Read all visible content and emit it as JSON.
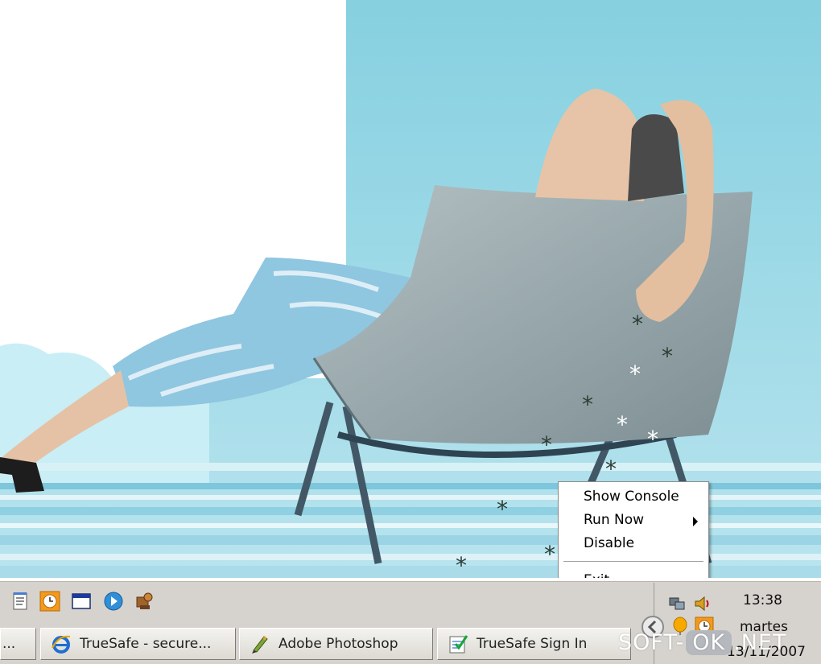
{
  "context_menu": {
    "items": [
      {
        "label": "Show Console",
        "has_submenu": false
      },
      {
        "label": "Run Now",
        "has_submenu": true
      },
      {
        "label": "Disable",
        "has_submenu": false
      },
      {
        "label": "Exit",
        "has_submenu": false
      }
    ]
  },
  "quick_launch": {
    "icons": [
      "notepad-icon",
      "clock-icon",
      "window-icon",
      "media-player-icon",
      "utility-icon"
    ]
  },
  "taskbar": {
    "buttons": [
      {
        "label": "...",
        "icon": "window-icon"
      },
      {
        "label": "TrueSafe - secure...",
        "icon": "internet-explorer-icon"
      },
      {
        "label": "Adobe Photoshop",
        "icon": "photoshop-icon"
      },
      {
        "label": "TrueSafe Sign In",
        "icon": "checklist-icon"
      }
    ]
  },
  "tray": {
    "time": "13:38",
    "day": "martes",
    "date": "13/11/2007",
    "icons": [
      "collapse-arrow-icon",
      "balloon-icon",
      "truesafe-clock-icon",
      "network-icon",
      "volume-icon"
    ]
  },
  "watermark": {
    "left": "SOFT-",
    "middle": "OK",
    "right": ".NET"
  },
  "colors": {
    "sky": "#9ed8e8",
    "wall": "#ffffff",
    "taskbar": "#d6d3ce",
    "chair": "#8f9fa4"
  }
}
